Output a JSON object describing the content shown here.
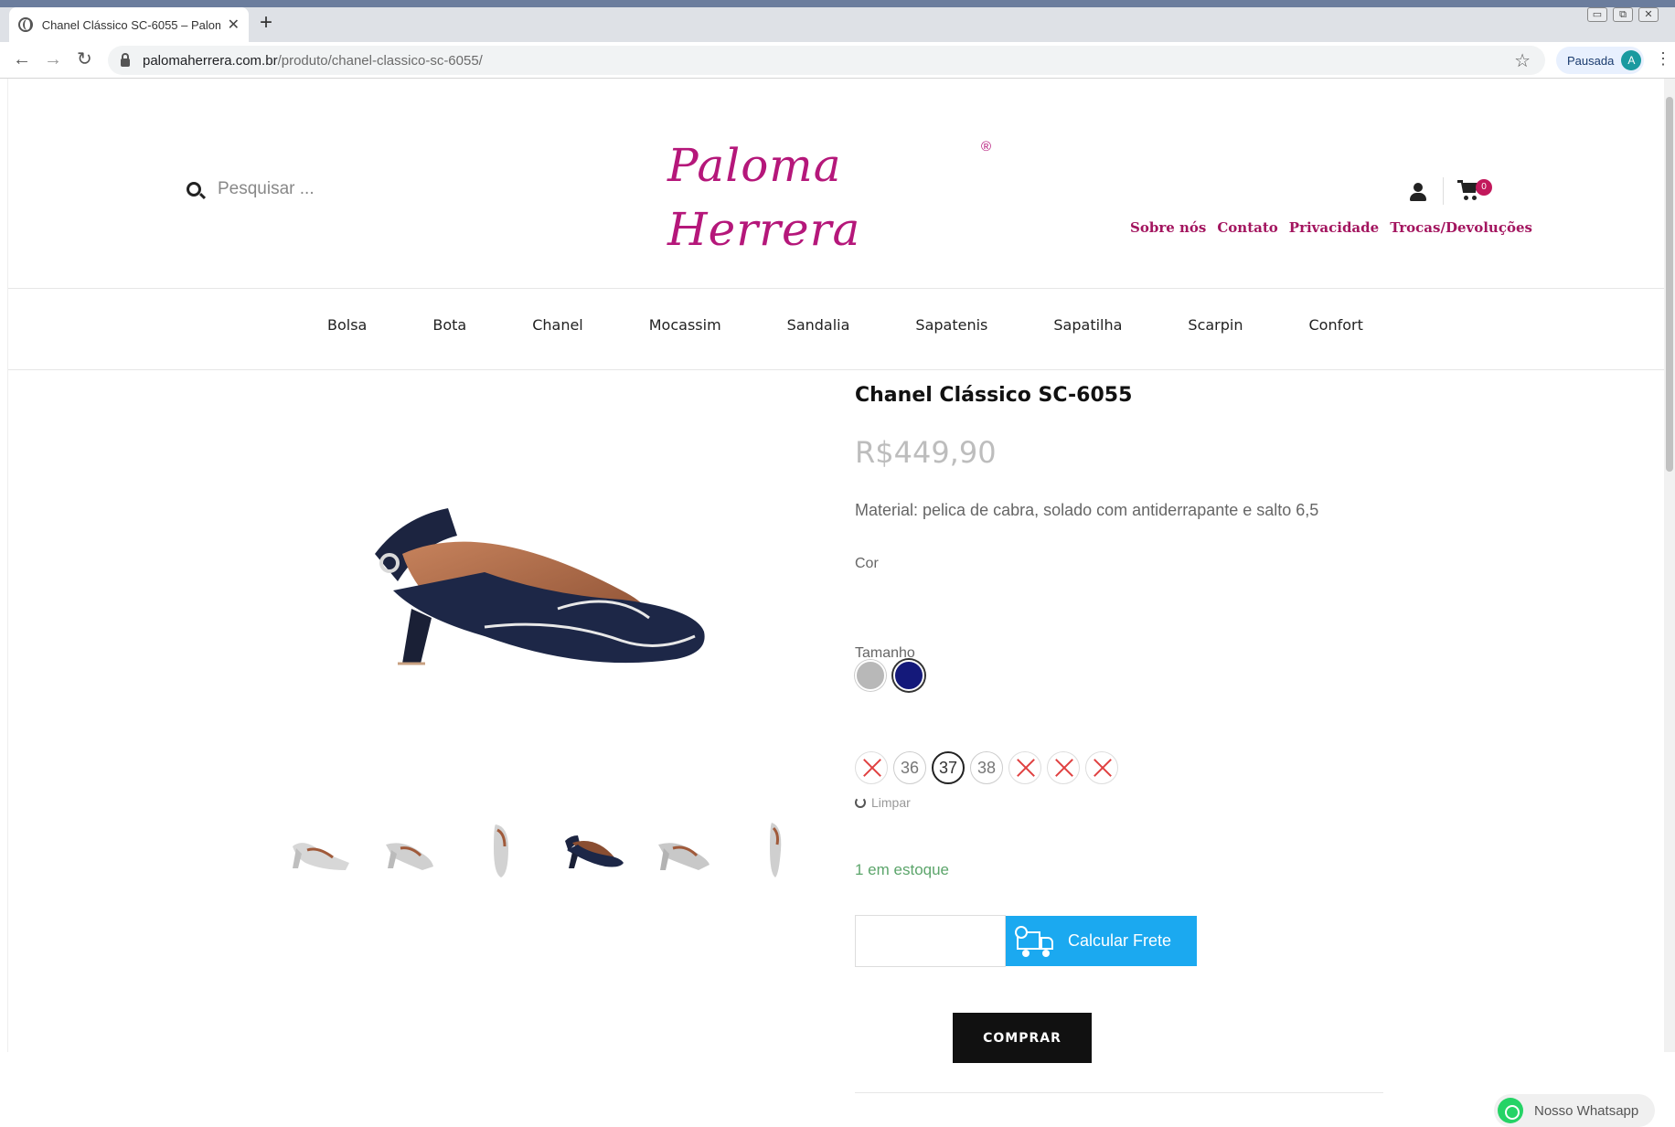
{
  "browser": {
    "tab_title": "Chanel Clássico SC-6055 – Palom",
    "tab_close": "✕",
    "new_tab": "+",
    "url_host": "palomaherrera.com.br",
    "url_path": "/produto/chanel-classico-sc-6055/",
    "back": "←",
    "forward": "→",
    "reload": "↻",
    "star": "☆",
    "profile_label": "Pausada",
    "profile_initial": "A",
    "menu": "⋮",
    "window_controls": [
      "▭",
      "⧉",
      "✕"
    ]
  },
  "header": {
    "search_placeholder": "Pesquisar ...",
    "logo_text": "Paloma Herrera",
    "logo_reg": "®",
    "cart_count": "0",
    "top_links": [
      "Sobre nós",
      "Contato",
      "Privacidade",
      "Trocas/Devoluções"
    ]
  },
  "nav": {
    "categories": [
      "Bolsa",
      "Bota",
      "Chanel",
      "Mocassim",
      "Sandalia",
      "Sapatenis",
      "Sapatilha",
      "Scarpin",
      "Confort"
    ]
  },
  "product": {
    "title": "Chanel Clássico SC-6055",
    "price": "R$449,90",
    "description": "Material: pelica de cabra, solado com antiderrapante e salto 6,5",
    "color_label": "Cor",
    "colors": [
      {
        "name": "silver",
        "hex": "#b8b8b8",
        "selected": false
      },
      {
        "name": "navy",
        "hex": "#14197a",
        "selected": true
      }
    ],
    "size_label": "Tamanho",
    "sizes": [
      {
        "value": "",
        "available": false
      },
      {
        "value": "36",
        "available": true
      },
      {
        "value": "37",
        "available": true,
        "selected": true
      },
      {
        "value": "38",
        "available": true
      },
      {
        "value": "",
        "available": false
      },
      {
        "value": "",
        "available": false
      },
      {
        "value": "",
        "available": false
      }
    ],
    "clear_label": "Limpar",
    "stock": "1 em estoque",
    "shipping_input_value": "",
    "shipping_button": "Calcular Frete",
    "buy_button": "COMPRAR"
  },
  "gallery": {
    "thumbnails": [
      "silver-side",
      "silver-front",
      "silver-top",
      "navy-side",
      "silver-front-2",
      "silver-top-2"
    ]
  },
  "whatsapp": {
    "label": "Nosso Whatsapp"
  },
  "colors": {
    "brand": "#b5177a",
    "link": "#a3155f",
    "badge": "#c2185b",
    "shipping_button": "#1ba9f0",
    "stock": "#5ca56b",
    "whatsapp": "#25d366"
  }
}
